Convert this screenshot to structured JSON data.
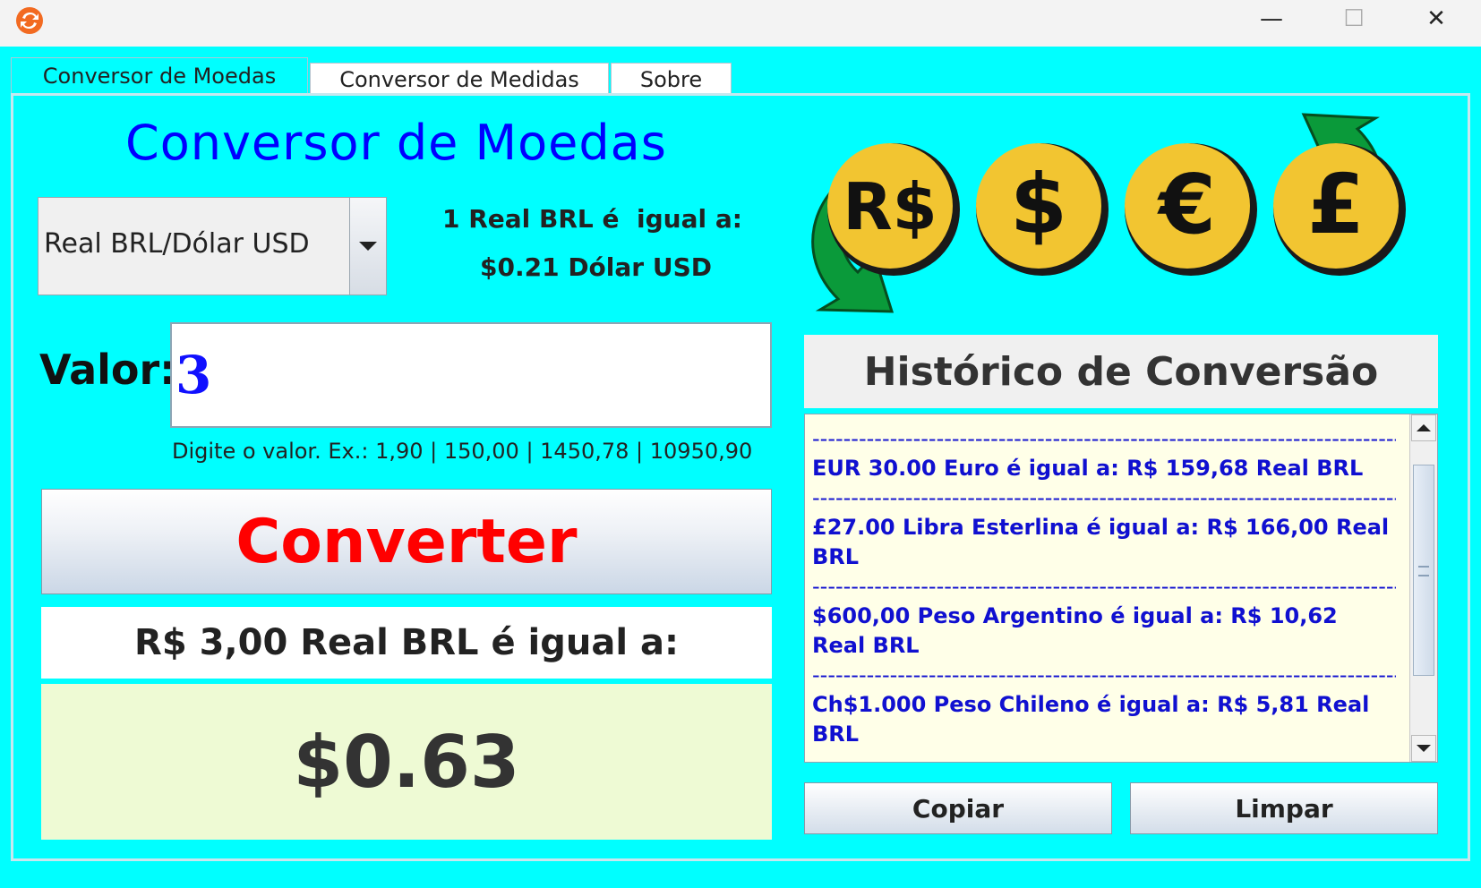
{
  "window": {
    "minimize_glyph": "—",
    "maximize_glyph": "☐",
    "close_glyph": "✕",
    "app_icon": "currency-exchange-icon"
  },
  "tabs": [
    {
      "label": "Conversor de Moedas",
      "active": true
    },
    {
      "label": "Conversor de Medidas",
      "active": false
    },
    {
      "label": "Sobre",
      "active": false
    }
  ],
  "main": {
    "heading": "Conversor de Moedas",
    "combo_value": "Real BRL/Dólar USD",
    "rate_line1": "1 Real BRL é  igual a:",
    "rate_line2": "$0.21 Dólar USD",
    "valor_label": "Valor:",
    "valor_input": "3",
    "hint": "Digite o valor. Ex.: 1,90 | 150,00 | 1450,78 | 10950,90",
    "convert_button": "Converter",
    "result_label": "R$ 3,00 Real BRL é igual a:",
    "result_value": "$0.63"
  },
  "coins": [
    "R$",
    "$",
    "€",
    "£"
  ],
  "history": {
    "title": "Histórico de Conversão",
    "separator": "-----------------------------------------------------------------------------------",
    "entries": [
      "EUR 30.00 Euro é igual a:  R$ 159,68 Real BRL",
      "£27.00 Libra Esterlina é igual a:  R$ 166,00 Real BRL",
      "$600,00 Peso Argentino é igual a:  R$ 10,62 Real BRL",
      "Ch$1.000 Peso Chileno é igual a:  R$ 5,81 Real BRL"
    ]
  },
  "buttons": {
    "copy": "Copiar",
    "clear": "Limpar"
  },
  "colors": {
    "background": "#00ffff",
    "heading": "#0000ff",
    "convert_text": "#ff0000",
    "history_text": "#1010d0",
    "history_bg": "#ffffe8",
    "result_bg": "#eefad4",
    "coin": "#f2c531",
    "arrow": "#0a9a3a"
  }
}
